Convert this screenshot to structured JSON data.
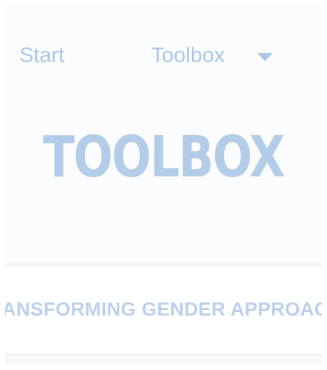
{
  "nav": {
    "start_label": "Start",
    "toolbox_label": "Toolbox",
    "dropdown_icon": "caret-down-icon"
  },
  "hero": {
    "title": "TOOLBOX"
  },
  "banner": {
    "text": "TRANSFORMING GENDER APPROACHES"
  },
  "colors": {
    "nav_text": "#aac7e6",
    "hero_title": "#b3cce8",
    "banner_text": "#bcd0ec",
    "background": "#fbfcfd"
  }
}
